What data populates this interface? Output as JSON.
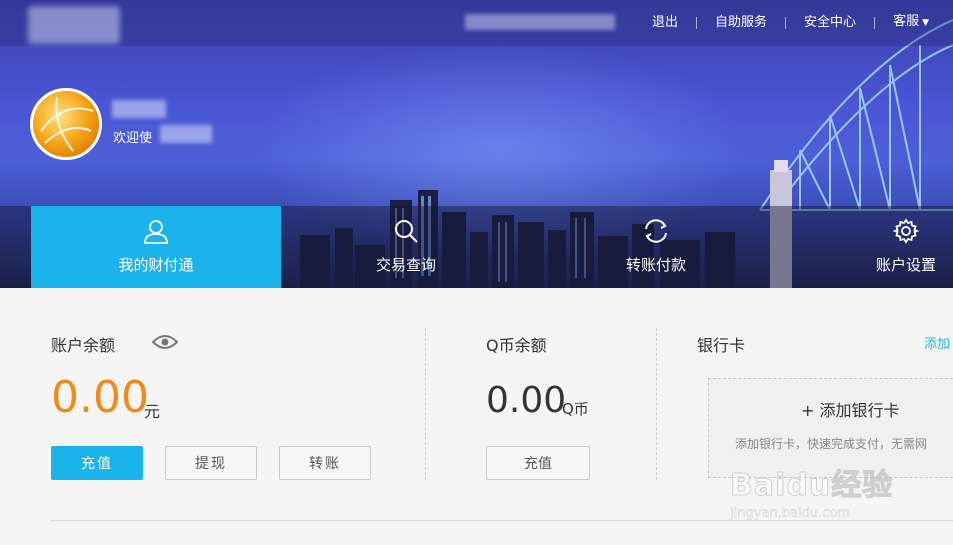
{
  "topbar": {
    "links": [
      "退出",
      "自助服务",
      "安全中心",
      "客服"
    ]
  },
  "user": {
    "welcome": "欢迎使"
  },
  "nav": {
    "tabs": [
      {
        "label": "我的财付通",
        "icon": "user-icon",
        "active": true
      },
      {
        "label": "交易查询",
        "icon": "search-icon",
        "active": false
      },
      {
        "label": "转账付款",
        "icon": "refresh-icon",
        "active": false
      },
      {
        "label": "账户设置",
        "icon": "gear-icon",
        "active": false
      }
    ]
  },
  "balance": {
    "title": "账户余额",
    "amount": "0.00",
    "unit": "元",
    "buttons": {
      "recharge": "充值",
      "withdraw": "提现",
      "transfer": "转账"
    }
  },
  "qcoin": {
    "title": "Q币余额",
    "amount": "0.00",
    "unit": "Q币",
    "button": "充值"
  },
  "bankcard": {
    "title": "银行卡",
    "add_link": "添加",
    "add_card": "+ 添加银行卡",
    "add_desc": "添加银行卡，快速完成支付，无需网"
  },
  "watermark": {
    "main": "Baidu经验",
    "sub": "jingyan.baidu.com"
  },
  "colors": {
    "accent": "#1ab3ea",
    "amount": "#f28a1a"
  }
}
